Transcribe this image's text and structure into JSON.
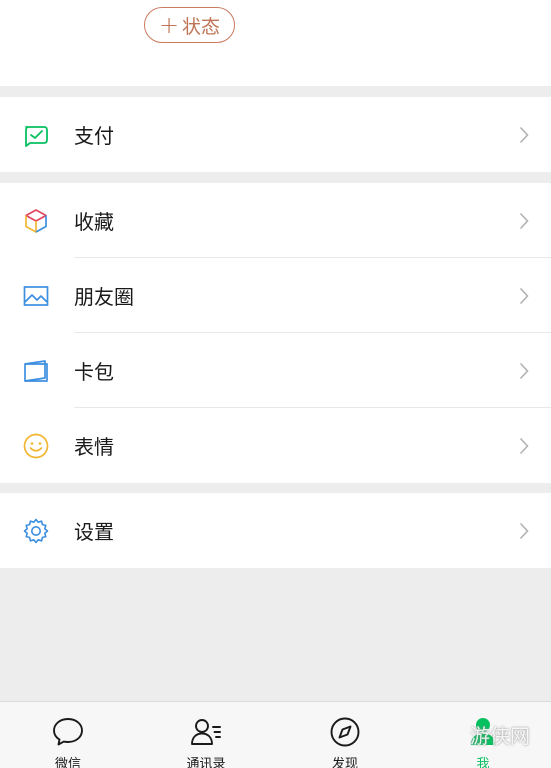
{
  "profile": {
    "status_button_label": "状态",
    "status_plus": "+"
  },
  "menu": {
    "pay": {
      "label": "支付",
      "icon": "wallet-check-icon"
    },
    "favorites": {
      "label": "收藏",
      "icon": "cube-icon"
    },
    "moments": {
      "label": "朋友圈",
      "icon": "picture-icon"
    },
    "cards": {
      "label": "卡包",
      "icon": "card-icon"
    },
    "stickers": {
      "label": "表情",
      "icon": "smiley-icon"
    },
    "settings": {
      "label": "设置",
      "icon": "gear-icon"
    }
  },
  "tabbar": [
    {
      "label": "微信",
      "icon": "chat-bubble-icon",
      "active": false
    },
    {
      "label": "通讯录",
      "icon": "contacts-icon",
      "active": false
    },
    {
      "label": "发现",
      "icon": "compass-icon",
      "active": false
    },
    {
      "label": "我",
      "icon": "person-icon",
      "active": true
    }
  ],
  "watermark": "游侠网",
  "colors": {
    "accent_green": "#07c160",
    "status_border": "#c97a5f",
    "background": "#ededed"
  }
}
